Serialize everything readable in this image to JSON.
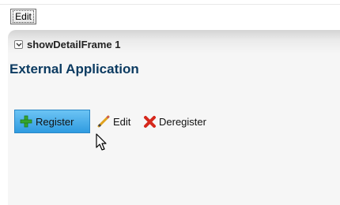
{
  "toolbar": {
    "edit_button_label": "Edit"
  },
  "frame": {
    "collapse_icon": "chevron-down-icon",
    "title": "showDetailFrame 1",
    "heading": "External Application"
  },
  "actions": {
    "register": {
      "label": "Register",
      "icon": "plus-icon",
      "state": "hover"
    },
    "edit": {
      "label": "Edit",
      "icon": "pencil-icon"
    },
    "deregister": {
      "label": "Deregister",
      "icon": "red-x-icon"
    }
  },
  "colors": {
    "heading": "#0c3b61",
    "register_highlight": "#2f9be0",
    "plus_icon": "#36a52e",
    "deregister_icon": "#d6281c"
  }
}
